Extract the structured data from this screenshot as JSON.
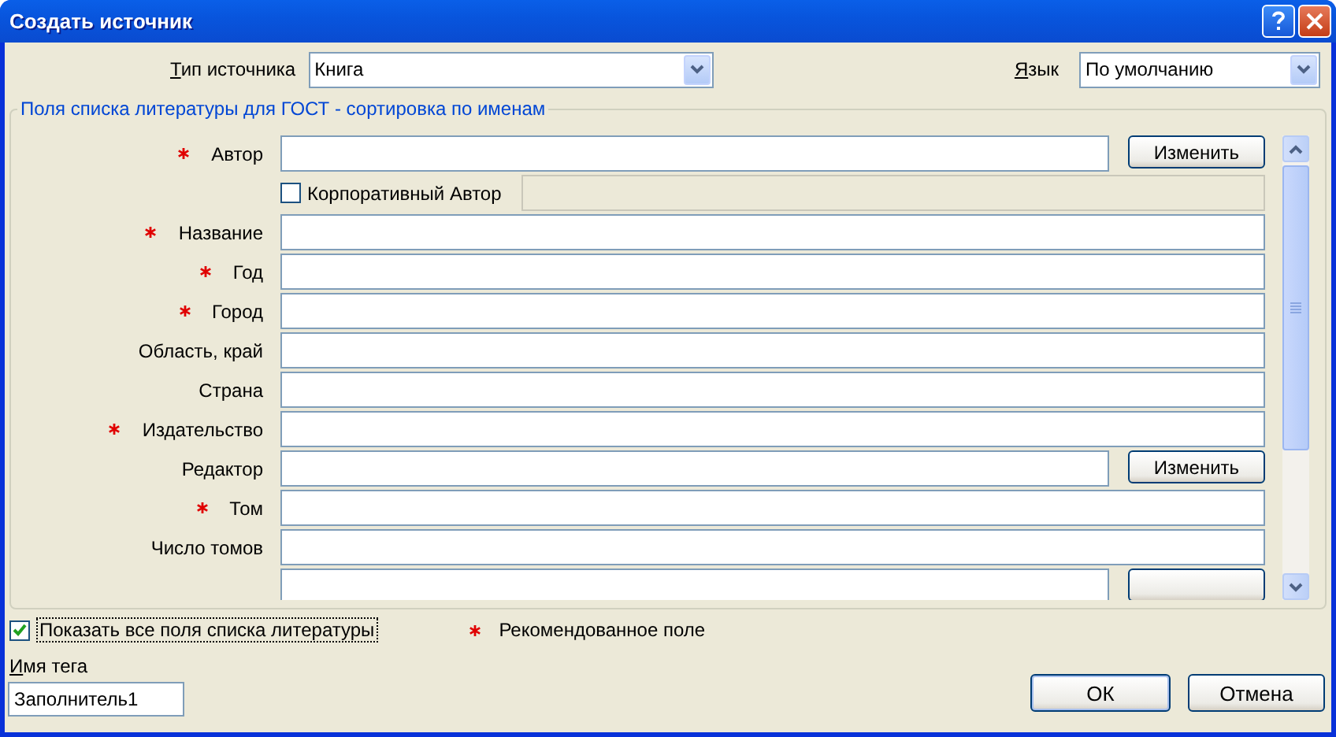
{
  "window": {
    "title": "Создать источник"
  },
  "source_type": {
    "label": "Тип источника",
    "value": "Книга"
  },
  "language": {
    "label": "Язык",
    "value": "По умолчанию"
  },
  "fields_group": {
    "title": "Поля списка литературы для ГОСТ - сортировка по именам",
    "rows": [
      {
        "kind": "field_with_button",
        "label": "Автор",
        "required": true,
        "button": "Изменить"
      },
      {
        "kind": "checkbox",
        "label": "Корпоративный Автор",
        "checked": false
      },
      {
        "kind": "field",
        "label": "Название",
        "required": true
      },
      {
        "kind": "field",
        "label": "Год",
        "required": true
      },
      {
        "kind": "field",
        "label": "Город",
        "required": true
      },
      {
        "kind": "field",
        "label": "Область, край",
        "required": false
      },
      {
        "kind": "field",
        "label": "Страна",
        "required": false
      },
      {
        "kind": "field",
        "label": "Издательство",
        "required": true
      },
      {
        "kind": "field_with_button",
        "label": "Редактор",
        "required": false,
        "button": "Изменить"
      },
      {
        "kind": "field",
        "label": "Том",
        "required": true
      },
      {
        "kind": "field",
        "label": "Число томов",
        "required": false
      },
      {
        "kind": "field_with_button",
        "required": false
      }
    ]
  },
  "show_all_fields": {
    "label": "Показать все поля списка литературы",
    "checked": true
  },
  "legend": {
    "label": "Рекомендованное поле"
  },
  "tag_name": {
    "label": "Имя тега",
    "value": "Заполнитель1"
  },
  "buttons": [
    {
      "label": "ОК"
    },
    {
      "label": "Отмена"
    }
  ]
}
